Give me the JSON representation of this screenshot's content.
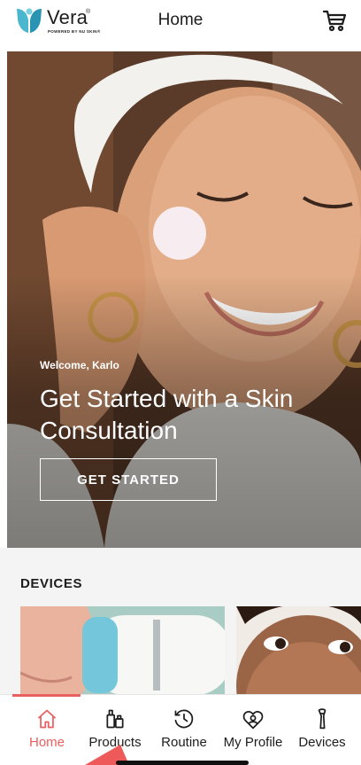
{
  "header": {
    "logo_text": "Vera",
    "logo_reg": "®",
    "logo_subtitle": "POWERED BY NU SKIN®",
    "title": "Home",
    "cart_icon": "cart-icon"
  },
  "hero": {
    "welcome": "Welcome, Karlo",
    "title": "Get Started with a Skin Consultation",
    "cta_label": "GET STARTED"
  },
  "devices": {
    "title": "DEVICES"
  },
  "nav": {
    "active": "Home",
    "accent_color": "#e8605f",
    "items": [
      {
        "label": "Home",
        "icon": "home-icon"
      },
      {
        "label": "Products",
        "icon": "products-icon"
      },
      {
        "label": "Routine",
        "icon": "routine-icon"
      },
      {
        "label": "My Profile",
        "icon": "profile-icon"
      },
      {
        "label": "Devices",
        "icon": "devices-icon"
      }
    ]
  }
}
